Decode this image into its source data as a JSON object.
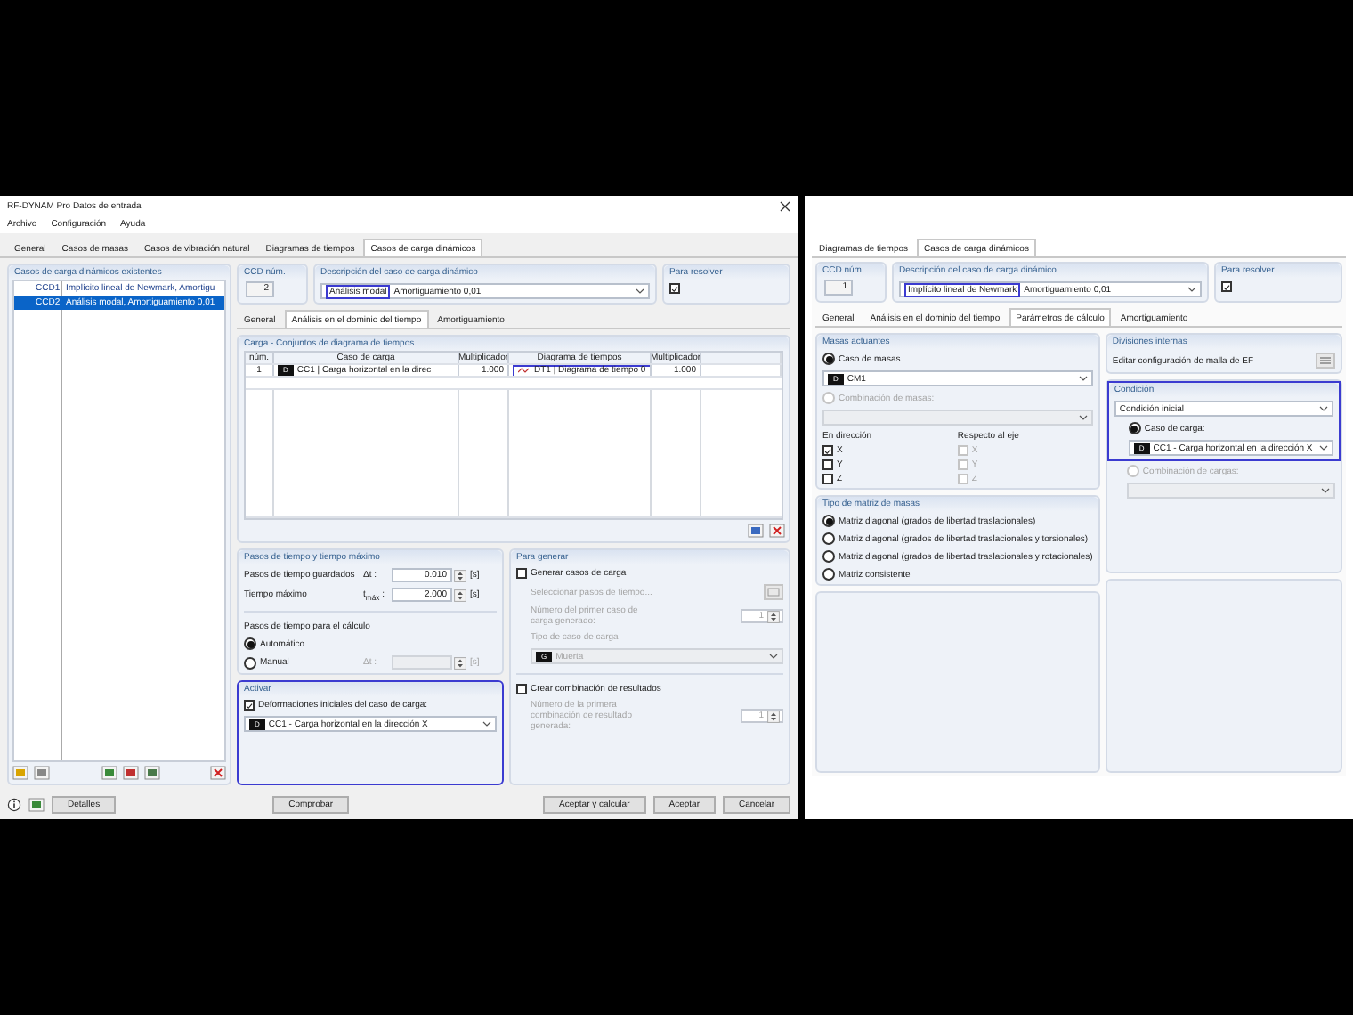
{
  "window": {
    "title": "RF-DYNAM Pro Datos de entrada"
  },
  "menu": [
    "Archivo",
    "Configuración",
    "Ayuda"
  ],
  "tabs": [
    {
      "label": "General",
      "selected": false
    },
    {
      "label": "Casos de masas",
      "selected": false
    },
    {
      "label": "Casos de vibración natural",
      "selected": false
    },
    {
      "label": "Diagramas de tiempos",
      "selected": false
    },
    {
      "label": "Casos de carga dinámicos",
      "selected": true
    }
  ],
  "case_list": {
    "title": "Casos de carga dinámicos existentes",
    "items": [
      {
        "id": "CCD1",
        "text": "Implícito lineal de Newmark, Amortigu",
        "selected": false
      },
      {
        "id": "CCD2",
        "text": "Análisis modal, Amortiguamiento 0,01",
        "selected": true
      }
    ]
  },
  "header": {
    "number_label": "CCD núm.",
    "number": "2",
    "description_label": "Descripción del caso de carga dinámico",
    "description_highlight": "Análisis modal",
    "highlighted": true,
    "description_rest": "Amortiguamiento 0,01",
    "solve_label": "Para resolver",
    "solve_checked": true
  },
  "subtabs": [
    {
      "label": "General",
      "selected": false
    },
    {
      "label": "Análisis en el dominio del tiempo",
      "selected": true
    },
    {
      "label": "Amortiguamiento",
      "selected": false
    }
  ],
  "load_table": {
    "title": "Carga - Conjuntos de diagrama de tiempos",
    "columns": [
      "núm.",
      "Caso de carga",
      "Multiplicador",
      "Diagrama de tiempos",
      "Multiplicador"
    ],
    "rows": [
      {
        "num": "1",
        "tag": "D",
        "load_case": "CC1 | Carga horizontal en la direc",
        "multiplier": "1.000",
        "diagram": "DT1 | Diagrama de tiempo 0",
        "diagram_highlighted": true,
        "multiplier_2": "1.000"
      }
    ]
  },
  "time_steps": {
    "title": "Pasos de tiempo y tiempo máximo",
    "fields": [
      {
        "label": "Pasos de tiempo guardados",
        "symbol": "Δt :",
        "value": "0.010",
        "unit": "[s]"
      },
      {
        "label": "Tiempo máximo",
        "symbol": "t$_{máx}$ :",
        "value": "2.000",
        "unit": "[s]"
      }
    ],
    "calc_title": "Pasos de tiempo para el cálculo",
    "options": [
      {
        "label": "Automático",
        "selected": true
      },
      {
        "label": "Manual",
        "selected": false
      }
    ],
    "manual_symbol": "Δt :",
    "manual_unit": "[s]"
  },
  "activate": {
    "title": "Activar",
    "highlighted": true,
    "checkbox": {
      "label": "Deformaciones iniciales del caso de carga:",
      "checked": true
    },
    "tag": "D",
    "value": "CC1 - Carga horizontal en la dirección X"
  },
  "generate": {
    "title": "Para generar",
    "generate_cases": {
      "label": "Generar casos de carga",
      "checked": false
    },
    "select_steps": "Seleccionar pasos de tiempo...",
    "first_case_label": "Número del primer caso de carga generado:",
    "first_case": "1",
    "type_label": "Tipo de caso de carga",
    "type_tag": "G",
    "type_value": "Muerta",
    "combination": {
      "label": "Crear combinación de resultados",
      "checked": false
    },
    "first_combo_label": "Número de la primera combinación de resultado generada:",
    "first_combo": "1"
  },
  "footer": {
    "details": "Detalles",
    "check": "Comprobar",
    "buttons": [
      "Aceptar y calcular",
      "Aceptar",
      "Cancelar"
    ]
  },
  "right_panel": {
    "tabs": [
      {
        "label": "Diagramas de tiempos",
        "selected": false
      },
      {
        "label": "Casos de carga dinámicos",
        "selected": true
      }
    ],
    "header": {
      "number_label": "CCD núm.",
      "number": "1",
      "description_label": "Descripción del caso de carga dinámico",
      "description_highlight": "Implícito lineal de Newmark",
      "highlighted": true,
      "description_rest": "Amortiguamiento 0,01",
      "solve_label": "Para resolver",
      "solve_checked": true
    },
    "subtabs": [
      {
        "label": "General",
        "selected": false
      },
      {
        "label": "Análisis en el dominio del tiempo",
        "selected": false
      },
      {
        "label": "Parámetros de cálculo",
        "selected": true
      },
      {
        "label": "Amortiguamiento",
        "selected": false
      }
    ],
    "masses": {
      "title": "Masas actuantes",
      "options": [
        {
          "label": "Caso de masas",
          "selected": true,
          "disabled": false
        },
        {
          "label": "Combinación de masas:",
          "selected": false,
          "disabled": true
        }
      ],
      "tag": "D",
      "mass_case": "CM1",
      "direction_title": "En dirección",
      "directions": [
        {
          "label": "X",
          "checked": true,
          "disabled": false
        },
        {
          "label": "Y",
          "checked": false,
          "disabled": false
        },
        {
          "label": "Z",
          "checked": false,
          "disabled": false
        }
      ],
      "axis_title": "Respecto al eje",
      "axes": [
        {
          "label": "X",
          "checked": false,
          "disabled": true
        },
        {
          "label": "Y",
          "checked": false,
          "disabled": true
        },
        {
          "label": "Z",
          "checked": false,
          "disabled": true
        }
      ]
    },
    "matrix": {
      "title": "Tipo de matriz de masas",
      "options": [
        {
          "label": "Matriz diagonal (grados de libertad traslacionales)",
          "selected": true
        },
        {
          "label": "Matriz diagonal (grados de libertad traslacionales y torsionales)",
          "selected": false
        },
        {
          "label": "Matriz diagonal (grados de libertad traslacionales y rotacionales)",
          "selected": false
        },
        {
          "label": "Matriz consistente",
          "selected": false
        }
      ]
    },
    "divisions": {
      "title": "Divisiones internas",
      "text": "Editar configuración de malla de EF"
    },
    "condition": {
      "title": "Condición",
      "highlighted": true,
      "value": "Condición inicial",
      "options": [
        {
          "label": "Caso de carga:",
          "selected": true,
          "disabled": false
        },
        {
          "label": "Combinación de cargas:",
          "selected": false,
          "disabled": true
        }
      ],
      "tag": "D",
      "load_case": "CC1 - Carga horizontal en la dirección X"
    }
  }
}
